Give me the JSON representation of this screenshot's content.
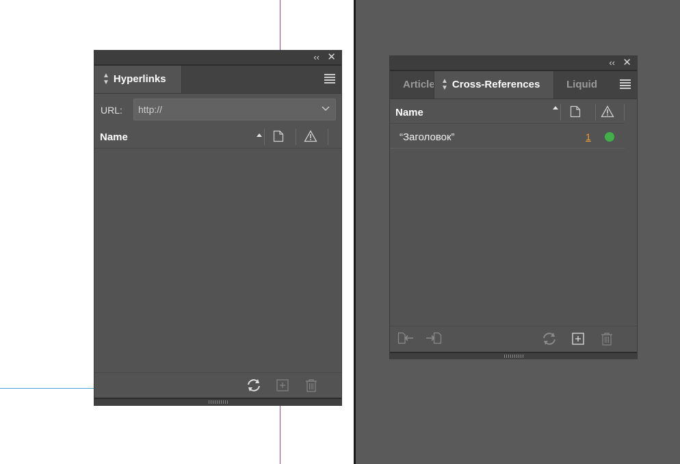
{
  "hyperlinks_panel": {
    "tab_label": "Hyperlinks",
    "url_label": "URL:",
    "url_value": "http://",
    "column_name": "Name"
  },
  "crossref_panel": {
    "tabs": [
      {
        "label": "Articles"
      },
      {
        "label": "Cross-References"
      },
      {
        "label": "Liquid"
      }
    ],
    "column_name": "Name",
    "rows": [
      {
        "name": "“Заголовок”",
        "page": "1",
        "status_color": "#3fb04a"
      }
    ]
  },
  "colors": {
    "panel_bg": "#535353",
    "tab_bar_bg": "#424242",
    "titlebar_bg": "#3d3d3d",
    "workspace_bg": "#5a5a5a",
    "pasteboard_bg": "#ffffff",
    "page_link_color": "#f0a030"
  }
}
